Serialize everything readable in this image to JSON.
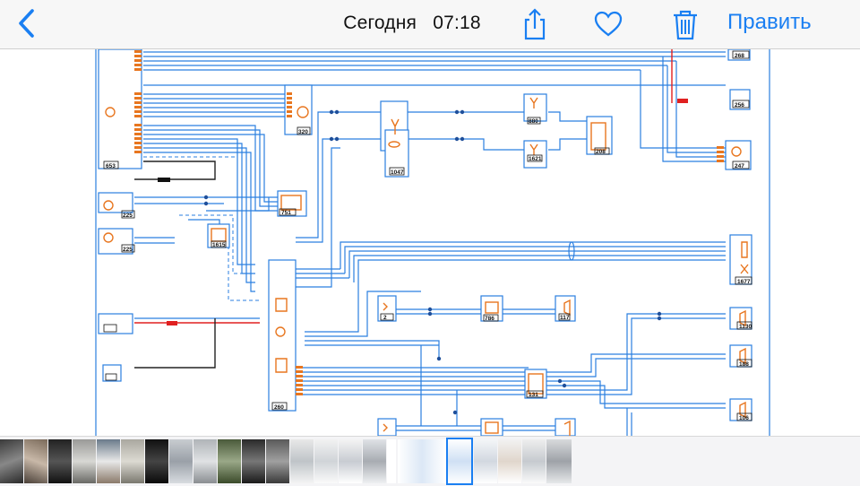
{
  "navbar": {
    "date_label": "Сегодня",
    "time_label": "07:18",
    "edit_label": "Править",
    "accent_color": "#1a7ff2",
    "icons": [
      "chevron-left-icon",
      "share-icon",
      "heart-icon",
      "trash-icon"
    ]
  },
  "diagram": {
    "labels": {
      "c1": "268",
      "c2": "256",
      "c3": "247",
      "c4": "653",
      "c5": "225",
      "c6": "225",
      "c7": "320",
      "c8": "1047",
      "c9": "880",
      "c10": "1621",
      "c11": "208",
      "c12": "1677",
      "c13": "260",
      "c14": "1130",
      "c15": "188",
      "c16": "106",
      "c17": "751",
      "c18": "1615",
      "c19": "786",
      "c20": "131",
      "c21": "2",
      "c22": "117"
    },
    "colors": {
      "wire": "#2b7fe0",
      "component": "#e8761f",
      "power": "#e02020",
      "ground": "#222222"
    }
  },
  "filmstrip": {
    "thumb_count": 24,
    "selected_index": 18
  }
}
